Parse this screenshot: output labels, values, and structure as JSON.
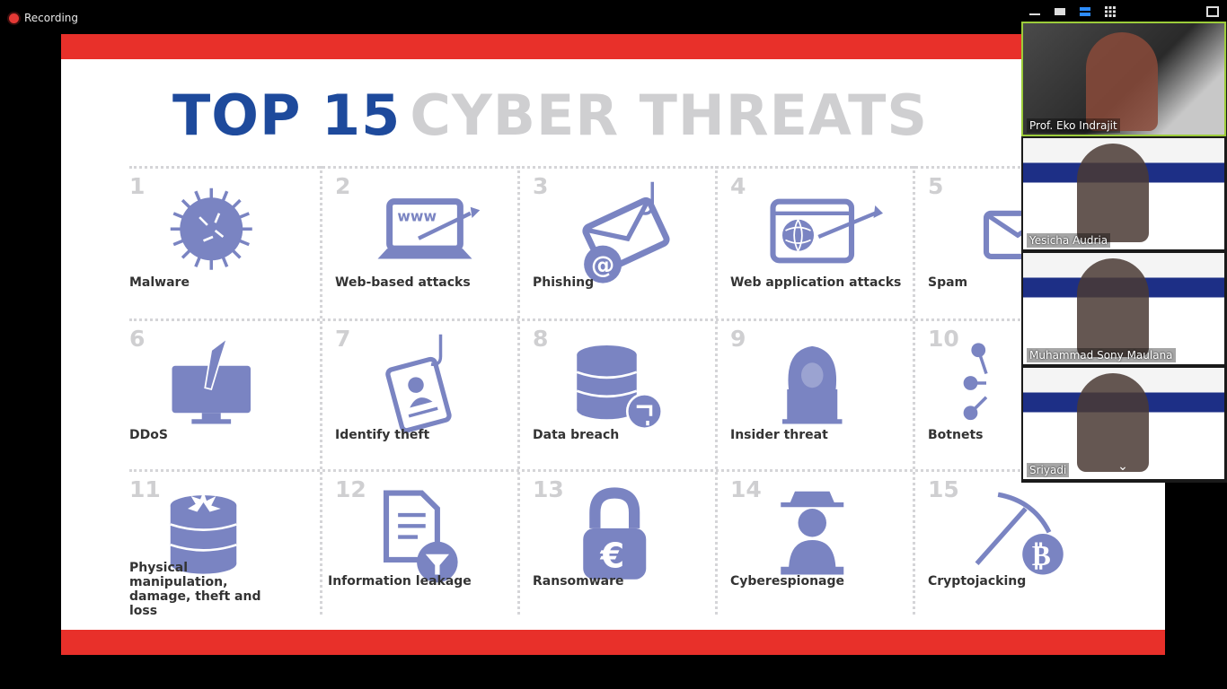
{
  "recording": {
    "label": "Recording"
  },
  "slide": {
    "title_part1": "TOP 15",
    "title_part2": "CYBER THREATS",
    "threats": [
      {
        "num": "1",
        "label": "Malware",
        "icon": "virus-icon"
      },
      {
        "num": "2",
        "label": "Web-based attacks",
        "icon": "laptop-www-arrow-icon"
      },
      {
        "num": "3",
        "label": "Phishing",
        "icon": "envelope-hook-icon"
      },
      {
        "num": "4",
        "label": "Web application attacks",
        "icon": "browser-globe-arrow-icon"
      },
      {
        "num": "5",
        "label": "Spam",
        "icon": "envelopes-icon"
      },
      {
        "num": "6",
        "label": "DDoS",
        "icon": "monitor-missile-icon"
      },
      {
        "num": "7",
        "label": "Identify theft",
        "icon": "id-card-hook-icon"
      },
      {
        "num": "8",
        "label": "Data breach",
        "icon": "database-leak-icon"
      },
      {
        "num": "9",
        "label": "Insider threat",
        "icon": "hooded-hacker-icon"
      },
      {
        "num": "10",
        "label": "Botnets",
        "icon": "network-nodes-icon"
      },
      {
        "num": "11",
        "label": "Physical manipulation, damage, theft and loss",
        "icon": "database-broken-icon"
      },
      {
        "num": "12",
        "label": "Information leakage",
        "icon": "document-funnel-icon"
      },
      {
        "num": "13",
        "label": "Ransomware",
        "icon": "padlock-euro-icon"
      },
      {
        "num": "14",
        "label": "Cyberespionage",
        "icon": "spy-laptop-icon"
      },
      {
        "num": "15",
        "label": "Cryptojacking",
        "icon": "pickaxe-bitcoin-icon"
      }
    ]
  },
  "participants": [
    {
      "name": "Prof. Eko Indrajit",
      "active": true
    },
    {
      "name": "Yesicha Audria"
    },
    {
      "name": "Muhammad Sony Maulana"
    },
    {
      "name": "Sriyadi"
    }
  ],
  "colors": {
    "accent_red": "#e8302a",
    "title_blue": "#1e4a9c",
    "icon_blue": "#7a84c2",
    "title_gray": "#cfcfd1"
  }
}
